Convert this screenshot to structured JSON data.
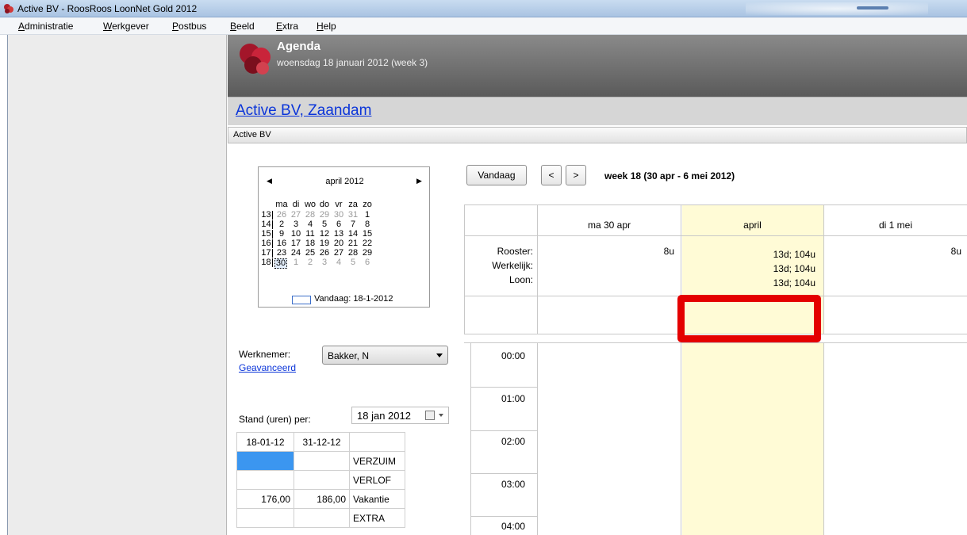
{
  "window": {
    "title": "Active BV - RoosRoos LoonNet Gold 2012"
  },
  "menu": [
    {
      "label": "Administratie",
      "key": "A"
    },
    {
      "label": "Werkgever",
      "key": "W"
    },
    {
      "label": "Postbus",
      "key": "P"
    },
    {
      "label": "Beeld",
      "key": "B"
    },
    {
      "label": "Extra",
      "key": "E"
    },
    {
      "label": "Help",
      "key": "H"
    }
  ],
  "header": {
    "title": "Agenda",
    "date": "woensdag 18 januari 2012 (week 3)",
    "company_link": "Active BV, Zaandam",
    "company_sub": "Active BV"
  },
  "mini_calendar": {
    "month": "april 2012",
    "weekdays": [
      "ma",
      "di",
      "wo",
      "do",
      "vr",
      "za",
      "zo"
    ],
    "rows": [
      {
        "week": "13",
        "days": [
          "26",
          "27",
          "28",
          "29",
          "30",
          "31",
          "1"
        ]
      },
      {
        "week": "14",
        "days": [
          "2",
          "3",
          "4",
          "5",
          "6",
          "7",
          "8"
        ]
      },
      {
        "week": "15",
        "days": [
          "9",
          "10",
          "11",
          "12",
          "13",
          "14",
          "15"
        ]
      },
      {
        "week": "16",
        "days": [
          "16",
          "17",
          "18",
          "19",
          "20",
          "21",
          "22"
        ]
      },
      {
        "week": "17",
        "days": [
          "23",
          "24",
          "25",
          "26",
          "27",
          "28",
          "29"
        ]
      },
      {
        "week": "18",
        "days": [
          "30",
          "1",
          "2",
          "3",
          "4",
          "5",
          "6"
        ]
      }
    ],
    "today_label": "Vandaag: 18-1-2012"
  },
  "toolbar": {
    "today_button": "Vandaag",
    "prev_button": "<",
    "next_button": ">",
    "week_label": "week 18 (30 apr - 6 mei 2012)"
  },
  "grid": {
    "days": [
      "ma 30 apr",
      "april",
      "di 1 mei"
    ],
    "row_labels": [
      "Rooster:",
      "Werkelijk:",
      "Loon:"
    ],
    "day0_values": [
      "8u"
    ],
    "day1_values": [
      "13d; 104u",
      "13d; 104u",
      "13d; 104u"
    ],
    "day2_values": [
      "8u"
    ],
    "hours": [
      "00:00",
      "01:00",
      "02:00",
      "03:00",
      "04:00"
    ]
  },
  "form": {
    "werknemer_label": "Werknemer:",
    "werknemer_value": "Bakker, N",
    "advanced_link": "Geavanceerd",
    "stand_label": "Stand (uren) per:",
    "stand_date": "18 jan 2012"
  },
  "stand_table": {
    "headers": [
      "18-01-12",
      "31-12-12",
      ""
    ],
    "rows": [
      [
        "",
        "",
        "VERZUIM"
      ],
      [
        "",
        "",
        "VERLOF"
      ],
      [
        "176,00",
        "186,00",
        "Vakantie"
      ],
      [
        "",
        "",
        "EXTRA"
      ]
    ]
  },
  "colors": {
    "highlight_column": "#fffbd6",
    "annotation_red": "#e40000",
    "link_blue": "#0b35d9"
  }
}
